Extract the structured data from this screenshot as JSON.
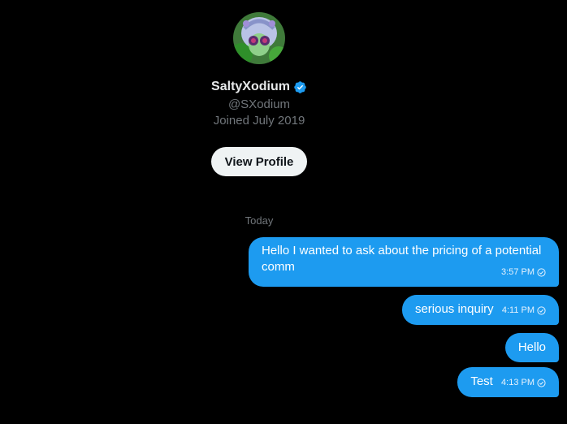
{
  "profile": {
    "display_name": "SaltyXodium",
    "handle": "@SXodium",
    "joined": "Joined July 2019",
    "view_profile_label": "View Profile"
  },
  "date_divider": "Today",
  "messages": [
    {
      "text": "Hello I wanted to ask about the pricing of a potential comm",
      "time": "3:57 PM",
      "status": "seen-check-icon"
    },
    {
      "text": "serious inquiry",
      "time": "4:11 PM",
      "status": "seen-check-icon"
    },
    {
      "text": "Hello",
      "time": "",
      "status": ""
    },
    {
      "text": "Test",
      "time": "4:13 PM",
      "status": "seen-check-icon"
    }
  ],
  "colors": {
    "background": "#000000",
    "bubble": "#1d9bf0",
    "verified": "#1d9bf0",
    "secondary_text": "#71767b",
    "button_bg": "#eff3f4"
  }
}
